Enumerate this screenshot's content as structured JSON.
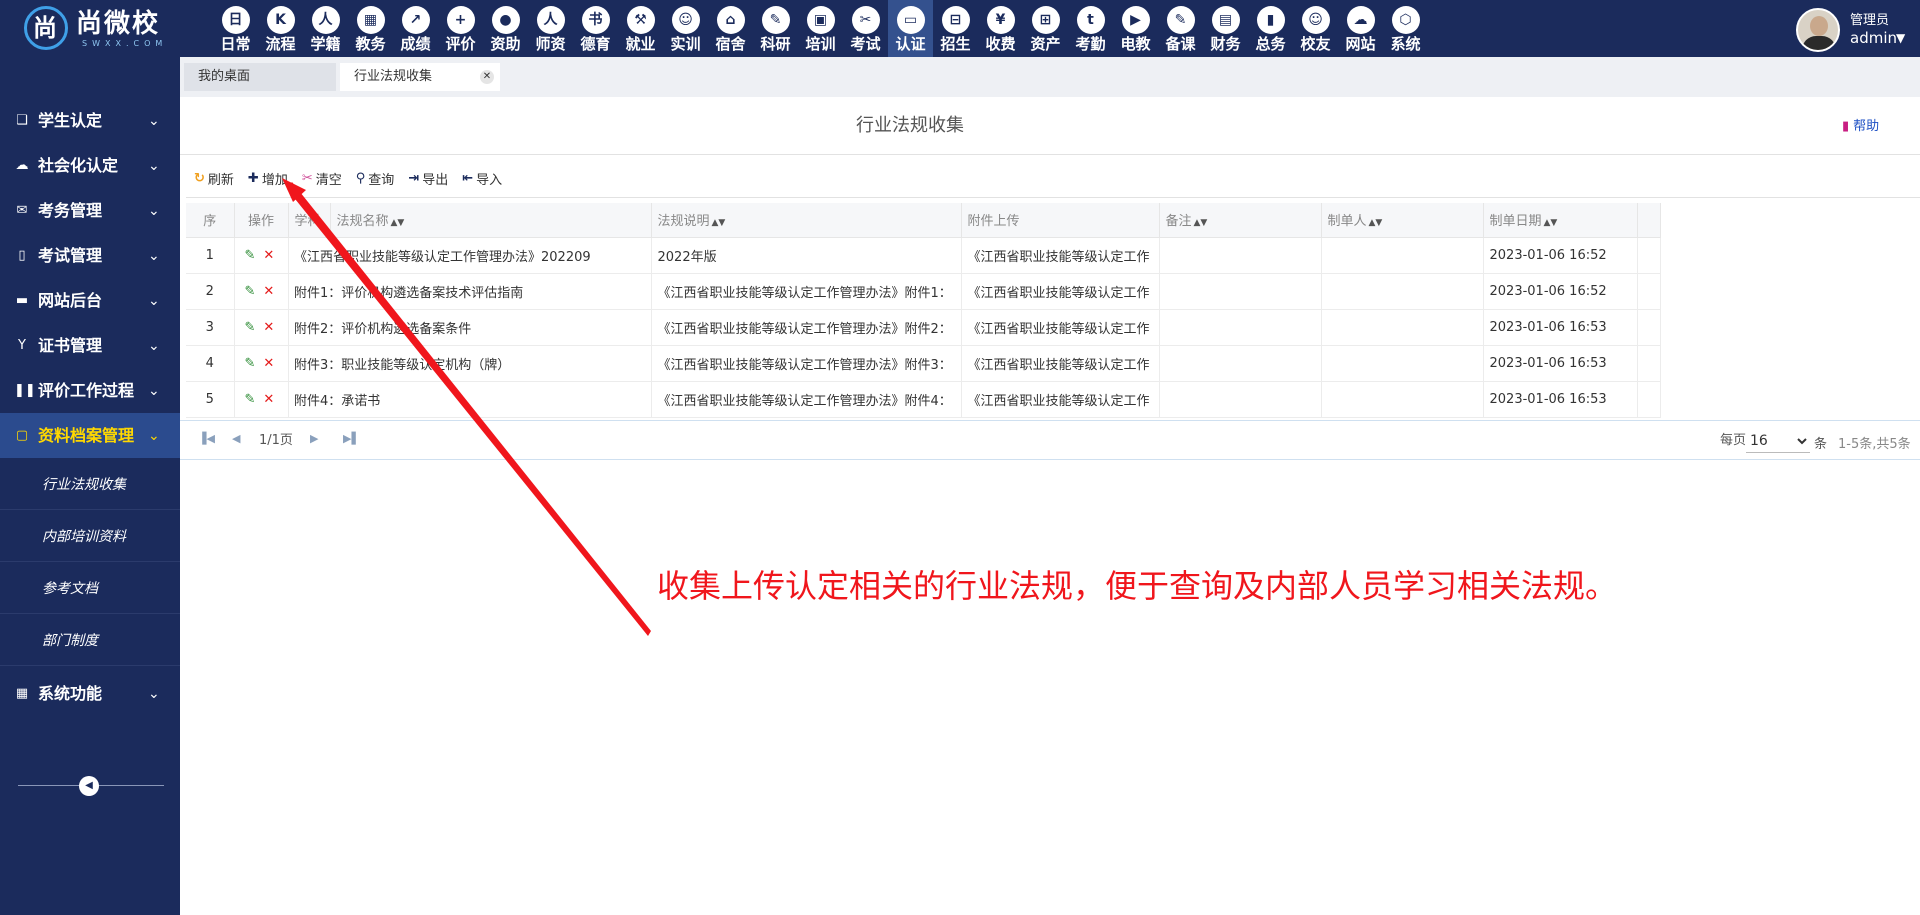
{
  "brand": {
    "name": "尚微校",
    "sub": "SWXX.COM",
    "glyph": "尚"
  },
  "modules": [
    {
      "label": "日常",
      "icon": "日",
      "active": false
    },
    {
      "label": "流程",
      "icon": "K",
      "active": false
    },
    {
      "label": "学籍",
      "icon": "人",
      "active": false
    },
    {
      "label": "教务",
      "icon": "▦",
      "active": false
    },
    {
      "label": "成绩",
      "icon": "↗",
      "active": false
    },
    {
      "label": "评价",
      "icon": "+",
      "active": false
    },
    {
      "label": "资助",
      "icon": "●",
      "active": false
    },
    {
      "label": "师资",
      "icon": "人",
      "active": false
    },
    {
      "label": "德育",
      "icon": "书",
      "active": false
    },
    {
      "label": "就业",
      "icon": "⚒",
      "active": false
    },
    {
      "label": "实训",
      "icon": "☺",
      "active": false
    },
    {
      "label": "宿舍",
      "icon": "⌂",
      "active": false
    },
    {
      "label": "科研",
      "icon": "✎",
      "active": false
    },
    {
      "label": "培训",
      "icon": "▣",
      "active": false
    },
    {
      "label": "考试",
      "icon": "✂",
      "active": false
    },
    {
      "label": "认证",
      "icon": "▭",
      "active": true
    },
    {
      "label": "招生",
      "icon": "⊟",
      "active": false
    },
    {
      "label": "收费",
      "icon": "¥",
      "active": false
    },
    {
      "label": "资产",
      "icon": "⊞",
      "active": false
    },
    {
      "label": "考勤",
      "icon": "t",
      "active": false
    },
    {
      "label": "电教",
      "icon": "▶",
      "active": false
    },
    {
      "label": "备课",
      "icon": "✎",
      "active": false
    },
    {
      "label": "财务",
      "icon": "▤",
      "active": false
    },
    {
      "label": "总务",
      "icon": "▮",
      "active": false
    },
    {
      "label": "校友",
      "icon": "☺",
      "active": false
    },
    {
      "label": "网站",
      "icon": "☁",
      "active": false
    },
    {
      "label": "系统",
      "icon": "⬡",
      "active": false
    }
  ],
  "user": {
    "role": "管理员",
    "name": "admin"
  },
  "sidebar": {
    "items": [
      {
        "label": "学生认定",
        "icon": "❑"
      },
      {
        "label": "社会化认定",
        "icon": "☁"
      },
      {
        "label": "考务管理",
        "icon": "✉"
      },
      {
        "label": "考试管理",
        "icon": "▯"
      },
      {
        "label": "网站后台",
        "icon": "▬"
      },
      {
        "label": "证书管理",
        "icon": "Y"
      },
      {
        "label": "评价工作过程",
        "icon": "❚❚"
      },
      {
        "label": "资料档案管理",
        "icon": "▢",
        "active": true
      },
      {
        "label": "系统功能",
        "icon": "▦"
      }
    ],
    "subitems": [
      "行业法规收集",
      "内部培训资料",
      "参考文档",
      "部门制度"
    ]
  },
  "tabs": [
    {
      "label": "我的桌面"
    },
    {
      "label": "行业法规收集"
    }
  ],
  "page": {
    "title": "行业法规收集",
    "help": "帮助"
  },
  "toolbar": {
    "refresh": "刷新",
    "add": "增加",
    "clear": "清空",
    "query": "查询",
    "export": "导出",
    "import": "导入"
  },
  "table": {
    "headers": [
      "序",
      "操作",
      "学科",
      "法规名称",
      "法规说明",
      "附件上传",
      "备注",
      "制单人",
      "制单日期"
    ],
    "rows": [
      {
        "no": "1",
        "name": "《江西省职业技能等级认定工作管理办法》202209",
        "desc": "2022年版",
        "attach": "《江西省职业技能等级认定工作",
        "remark": "",
        "maker": "",
        "date": "2023-01-06 16:52"
      },
      {
        "no": "2",
        "name": "附件1：评价机构遴选备案技术评估指南",
        "desc": "《江西省职业技能等级认定工作管理办法》附件1：",
        "attach": "《江西省职业技能等级认定工作",
        "remark": "",
        "maker": "",
        "date": "2023-01-06 16:52"
      },
      {
        "no": "3",
        "name": "附件2：评价机构遴选备案条件",
        "desc": "《江西省职业技能等级认定工作管理办法》附件2：",
        "attach": "《江西省职业技能等级认定工作",
        "remark": "",
        "maker": "",
        "date": "2023-01-06 16:53"
      },
      {
        "no": "4",
        "name": "附件3：职业技能等级认定机构（牌）",
        "desc": "《江西省职业技能等级认定工作管理办法》附件3：",
        "attach": "《江西省职业技能等级认定工作",
        "remark": "",
        "maker": "",
        "date": "2023-01-06 16:53"
      },
      {
        "no": "5",
        "name": "附件4：承诺书",
        "desc": "《江西省职业技能等级认定工作管理办法》附件4：",
        "attach": "《江西省职业技能等级认定工作",
        "remark": "",
        "maker": "",
        "date": "2023-01-06 16:53"
      }
    ]
  },
  "pager": {
    "page_text": "1/1页",
    "per_label": "每页",
    "per_value": "16",
    "unit": "条",
    "total": "1-5条,共5条"
  },
  "annotation": {
    "text": "收集上传认定相关的行业法规，便于查询及内部人员学习相关法规。",
    "color": "#f0161c"
  },
  "colors": {
    "nav_bg": "#1b2b5c",
    "active_nav": "#ffd800",
    "link": "#1d4fc4"
  }
}
